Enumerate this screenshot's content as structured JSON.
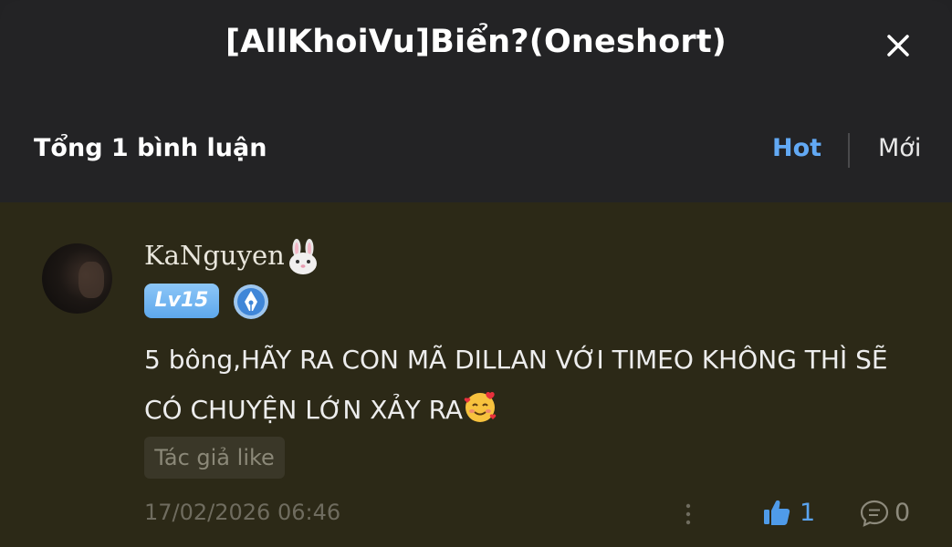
{
  "header": {
    "title": "[AllKhoiVu]Biển?(Oneshort)",
    "close_icon": "close-icon"
  },
  "comments_bar": {
    "count_label": "Tổng 1 bình luận",
    "tabs": [
      {
        "label": "Hot",
        "active": true
      },
      {
        "label": "Mới",
        "active": false
      }
    ]
  },
  "comment": {
    "username": "KaNguyen",
    "username_emoji": "rabbit-face",
    "level_label": "Lv15",
    "badge_icon": "pen-badge-icon",
    "text": "5 bông,HÃY RA CON MÃ DILLAN VỚI TIMEO KHÔNG THÌ SẼ CÓ CHUYỆN LỚN XẢY RA",
    "text_emoji": "smiling-face-with-hearts",
    "author_like_label": "Tác giả like",
    "timestamp": "17/02/2026 06:46",
    "likes": "1",
    "replies": "0"
  },
  "colors": {
    "background": "#232325",
    "comment_background": "#2c2917",
    "accent": "#62a9f4",
    "level_badge": "#6fb2ef"
  }
}
